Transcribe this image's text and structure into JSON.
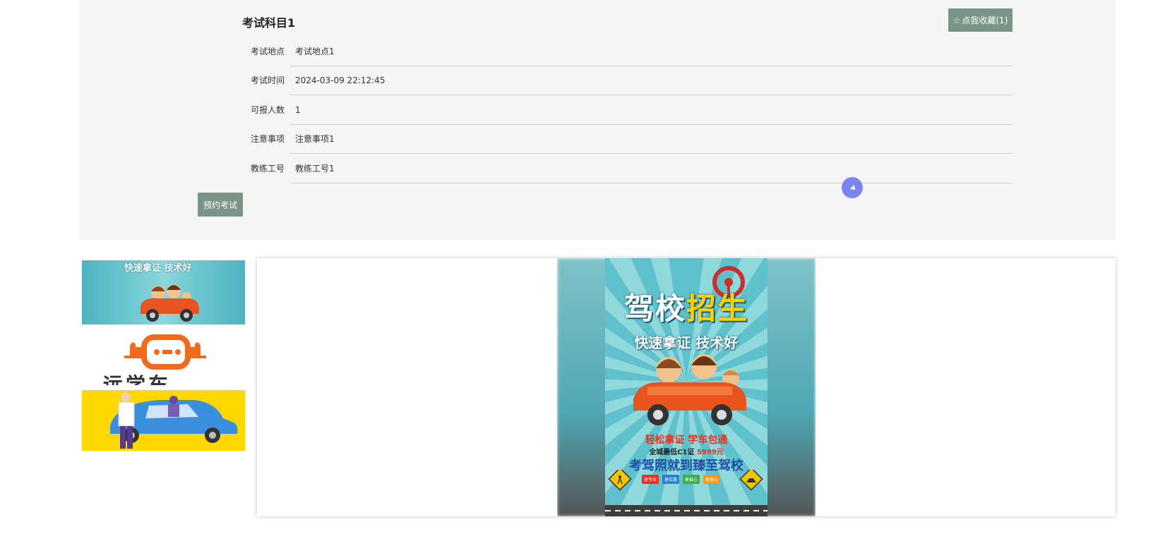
{
  "subject": {
    "title": "考试科目1",
    "favorite_label": "点我收藏(1)",
    "favorite_icon": "star-outline-icon"
  },
  "fields": [
    {
      "label": "考试地点",
      "value": "考试地点1"
    },
    {
      "label": "考试时间",
      "value": "2024-03-09 22:12:45"
    },
    {
      "label": "可报人数",
      "value": "1"
    },
    {
      "label": "注意事项",
      "value": "注意事项1"
    },
    {
      "label": "教练工号",
      "value": "教练工号1"
    }
  ],
  "actions": {
    "book_label": "预约考试"
  },
  "gallery": {
    "thumb1_caption": "快速拿证 技术好",
    "thumb2_text": "远学车",
    "poster": {
      "headline_main": "驾校",
      "headline_highlight": "招生",
      "subtitle": "快速拿证 技术好",
      "slogan1": "轻松拿证 学车包通",
      "slogan2_prefix": "全城最低C1证",
      "slogan2_price": "5999元",
      "slogan3": "考驾照就到臻至驾校",
      "chips": [
        {
          "text": "更专业",
          "color": "#e8321f"
        },
        {
          "text": "更实惠",
          "color": "#2a7fd4"
        },
        {
          "text": "更省心",
          "color": "#3fae49"
        },
        {
          "text": "更放心",
          "color": "#f39a1e"
        }
      ]
    }
  },
  "colors": {
    "button_bg": "#7a9488",
    "panel_bg": "#f5f5f5"
  }
}
